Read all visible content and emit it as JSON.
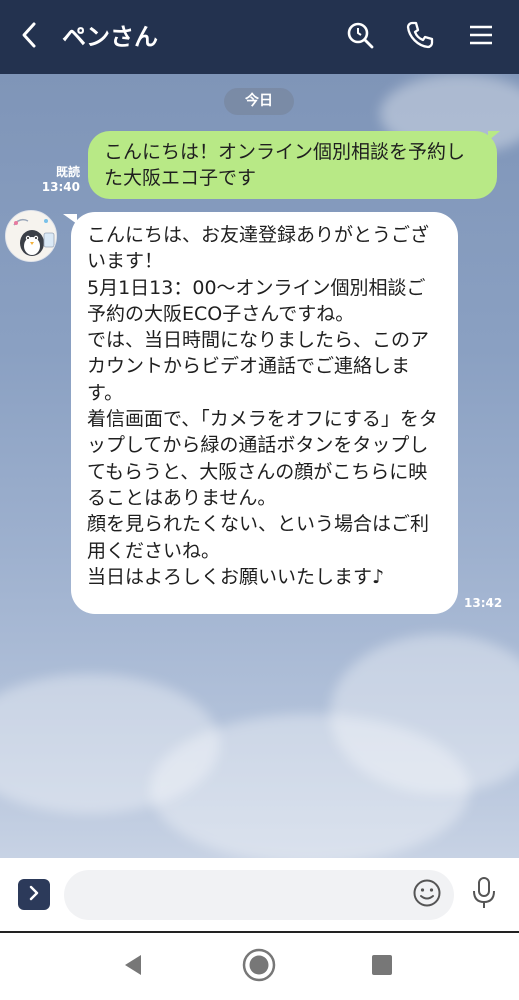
{
  "header": {
    "title": "ペンさん",
    "back_icon": "chevron-left-icon",
    "actions": [
      "search-icon",
      "phone-icon",
      "menu-icon"
    ],
    "background": "#23324f"
  },
  "chat": {
    "date_label": "今日",
    "messages": [
      {
        "direction": "sent",
        "text": "こんにちは！オンライン個別相談を予約した大阪エコ子です",
        "read_label": "既読",
        "time": "13:40",
        "bubble_color": "#b8e986"
      },
      {
        "direction": "received",
        "avatar": "penguin-avatar",
        "text": "こんにちは、お友達登録ありがとうございます！\n5月1日13：00〜オンライン個別相談ご予約の大阪ECO子さんですね。\nでは、当日時間になりましたら、このアカウントからビデオ通話でご連絡します。\n着信画面で、「カメラをオフにする」をタップしてから緑の通話ボタンをタップしてもらうと、大阪さんの顔がこちらに映ることはありません。\n顔を見られたくない、という場合はご利用くださいね。\n当日はよろしくお願いいたします♪",
        "time": "13:42",
        "bubble_color": "#ffffff"
      }
    ]
  },
  "input_bar": {
    "placeholder": "",
    "value": "",
    "icons": [
      "expand-icon",
      "emoji-icon",
      "mic-icon"
    ]
  },
  "system_nav": {
    "icons": [
      "back-triangle-icon",
      "home-circle-icon",
      "recents-square-icon"
    ]
  }
}
